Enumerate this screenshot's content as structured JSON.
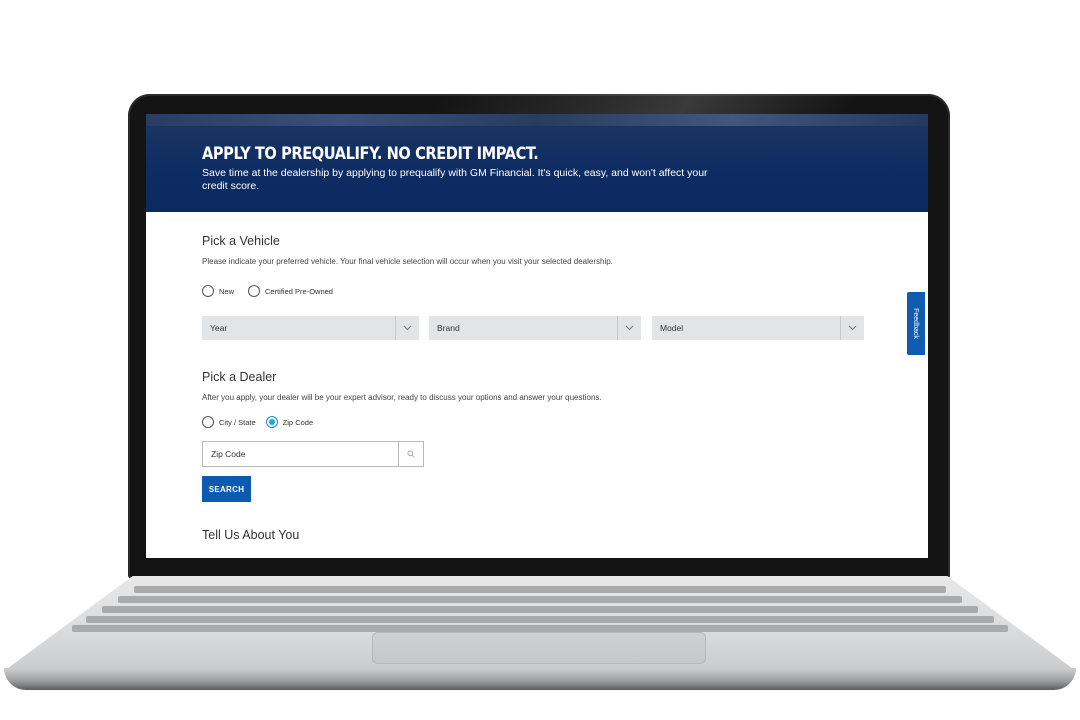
{
  "hero": {
    "title": "APPLY TO PREQUALIFY. NO CREDIT IMPACT.",
    "subtitle": "Save time at the dealership by applying to prequalify with GM Financial. It's quick, easy, and won't affect your credit score."
  },
  "vehicle": {
    "title": "Pick a Vehicle",
    "description": "Please indicate your preferred vehicle. Your final vehicle selection will occur when you visit your selected dealership.",
    "condition_options": [
      {
        "label": "New",
        "selected": false
      },
      {
        "label": "Certified Pre-Owned",
        "selected": false
      }
    ],
    "selects": {
      "year": "Year",
      "brand": "Brand",
      "model": "Model"
    }
  },
  "dealer": {
    "title": "Pick a Dealer",
    "description": "After you apply, your dealer will be your expert advisor, ready to discuss your options and answer your questions.",
    "location_options": [
      {
        "label": "City / State",
        "selected": false
      },
      {
        "label": "Zip Code",
        "selected": true
      }
    ],
    "zip_placeholder": "Zip Code",
    "search_label": "SEARCH"
  },
  "about": {
    "title": "Tell Us About You"
  },
  "feedback": {
    "label": "Feedback"
  },
  "colors": {
    "hero_bg": "#0d2c63",
    "primary_button": "#0b5bb0",
    "radio_checked": "#1aa7e8",
    "select_bg": "#e3e4e6"
  }
}
